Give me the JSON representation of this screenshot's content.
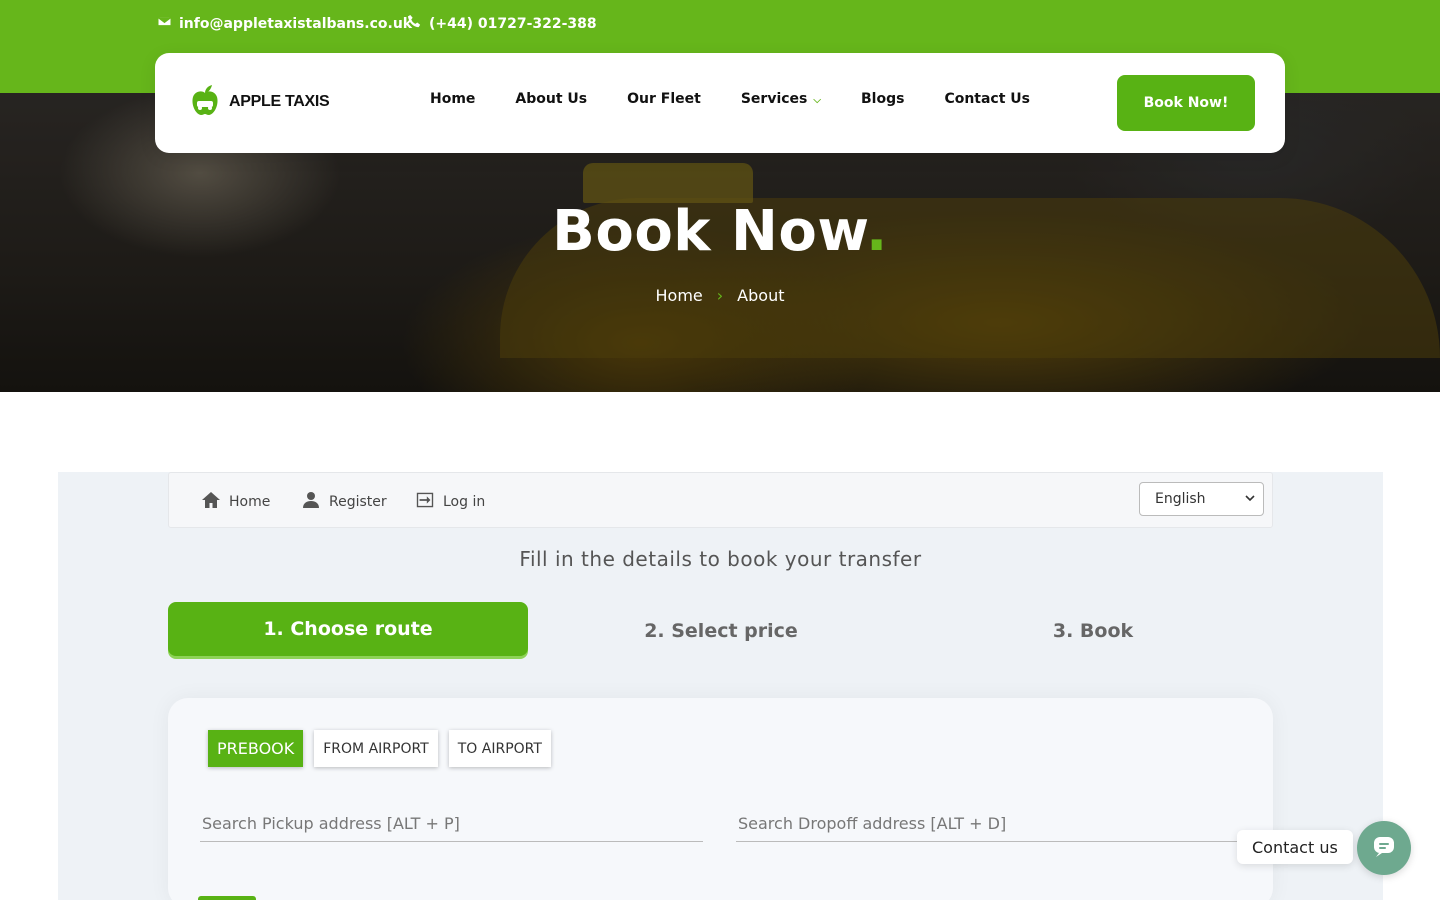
{
  "topbar": {
    "email": "info@appletaxistalbans.co.uk",
    "phone": "(+44) 01727-322-388"
  },
  "header": {
    "logo_text": "APPLE TAXIS",
    "nav": [
      "Home",
      "About Us",
      "Our Fleet",
      "Services",
      "Blogs",
      "Contact Us"
    ],
    "cta": "Book Now!"
  },
  "hero": {
    "title": "Book Now",
    "title_dot": ".",
    "breadcrumb": [
      "Home",
      "About"
    ]
  },
  "booking": {
    "toolbar": {
      "home": "Home",
      "register": "Register",
      "login": "Log in",
      "language": "English"
    },
    "intro": "Fill in the details to book your transfer",
    "steps": [
      "1. Choose route",
      "2. Select price",
      "3. Book"
    ],
    "tabs": [
      "PREBOOK",
      "FROM AIRPORT",
      "TO AIRPORT"
    ],
    "pickup_placeholder": "Search Pickup address [ALT + P]",
    "dropoff_placeholder": "Search Dropoff address [ALT + D]"
  },
  "widget": {
    "label": "Contact us"
  },
  "colors": {
    "brand_green": "#66b61b",
    "button_green": "#58b214",
    "widget_teal": "#6ea98f"
  }
}
